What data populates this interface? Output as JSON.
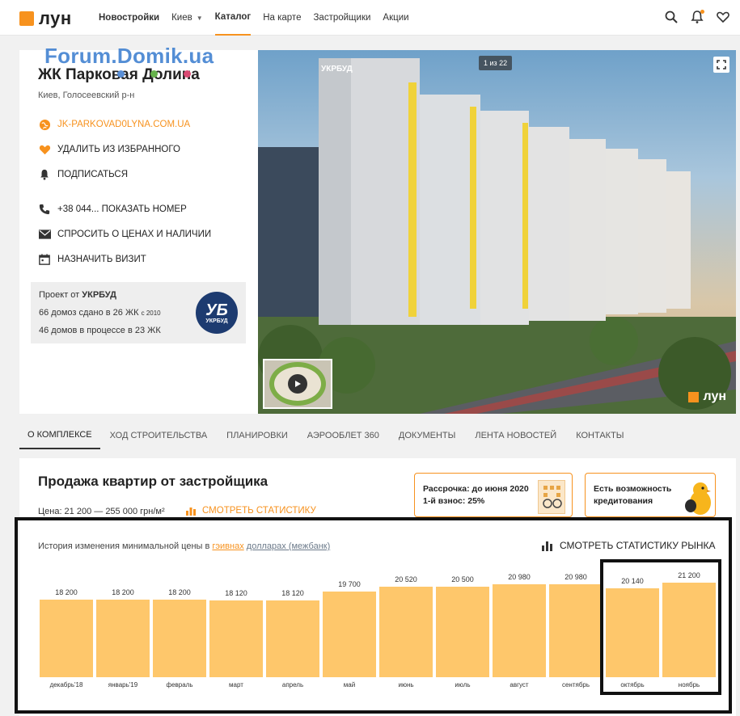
{
  "header": {
    "logo_text": "лун",
    "nav": {
      "new_buildings": "Новостройки",
      "city": "Киев",
      "catalog": "Каталог",
      "on_map": "На карте",
      "developers": "Застройщики",
      "promotions": "Акции"
    },
    "accent_color": "#f7921e"
  },
  "watermark": "Forum.Domik.ua",
  "complex": {
    "title": "ЖК Парковая Долина",
    "location": "Киев, Голосеевский р-н",
    "website": "JK-PARKOVAD0LYNA.COM.UA",
    "favorite": "УДАЛИТЬ ИЗ ИЗБРАННОГО",
    "subscribe": "ПОДПИСАТЬСЯ",
    "phone": "+38 044... ПОКАЗАТЬ НОМЕР",
    "ask_prices": "СПРОСИТЬ О ЦЕНАХ И НАЛИЧИИ",
    "visit": "НАЗНАЧИТЬ ВИЗИТ"
  },
  "developer": {
    "project_by": "Проект от",
    "name": "УКРБУД",
    "built_line": "66 домоз сдано в 26 ЖК",
    "built_since": "с 2010",
    "in_progress": "46 домов в процессе в 23 ЖК",
    "logo_big": "УБ",
    "logo_small": "УКРБУД"
  },
  "photo": {
    "counter": "1 из 22",
    "brand": "лун",
    "facade_label": "УКРБУД"
  },
  "tabs": [
    "О КОМПЛЕКСЕ",
    "ХОД СТРОИТЕЛЬСТВА",
    "ПЛАНИРОВКИ",
    "АЭРООБЛЕТ 360",
    "ДОКУМЕНТЫ",
    "ЛЕНТА НОВОСТЕЙ",
    "КОНТАКТЫ"
  ],
  "sales": {
    "title": "Продажа квартир от застройщика",
    "price": "Цена: 21 200 — 255 000 грн/м²",
    "stats_link": "СМОТРЕТЬ СТАТИСТИКУ",
    "promo1_line1": "Рассрочка: до июня 2020",
    "promo1_line2": "1-й взнос: 25%",
    "promo2_line1": "Есть возможность",
    "promo2_line2": "кредитования"
  },
  "history": {
    "label": "История изменения минимальной цены в",
    "currency_uah": "гэивнах",
    "currency_usd": "долларах (межбанк)",
    "market_link": "СМОТРЕТЬ СТАТИСТИКУ РЫНКА"
  },
  "chart_data": {
    "type": "bar",
    "categories": [
      "декабрь'18",
      "январь'19",
      "февраль",
      "март",
      "апрель",
      "май",
      "июнь",
      "июль",
      "август",
      "сентябрь",
      "октябрь",
      "ноябрь"
    ],
    "values": [
      18200,
      18200,
      18200,
      18120,
      18120,
      19700,
      20520,
      20500,
      20980,
      20980,
      20140,
      21200
    ],
    "value_labels": [
      "18 200",
      "18 200",
      "18 200",
      "18 120",
      "18 120",
      "19 700",
      "20 520",
      "20 500",
      "20 980",
      "20 980",
      "20 140",
      "21 200"
    ],
    "bar_color": "#fec76b",
    "ylim": [
      0,
      22000
    ]
  }
}
